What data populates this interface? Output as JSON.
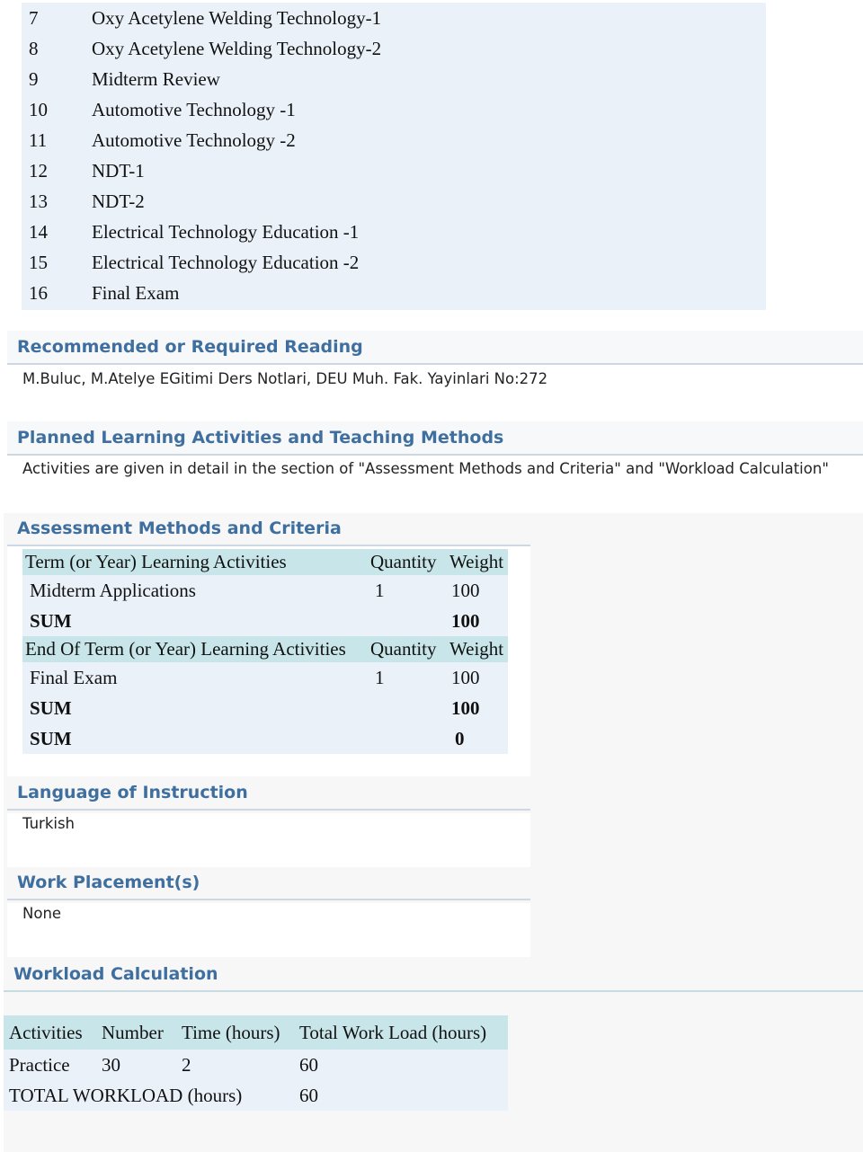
{
  "weekly_schedule": [
    {
      "week": "7",
      "topic": "Oxy Acetylene Welding Technology-1"
    },
    {
      "week": "8",
      "topic": "Oxy Acetylene Welding Technology-2"
    },
    {
      "week": "9",
      "topic": "Midterm Review"
    },
    {
      "week": "10",
      "topic": "Automotive Technology -1"
    },
    {
      "week": "11",
      "topic": "Automotive Technology -2"
    },
    {
      "week": "12",
      "topic": "NDT-1"
    },
    {
      "week": "13",
      "topic": "NDT-2"
    },
    {
      "week": "14",
      "topic": "Electrical Technology Education -1"
    },
    {
      "week": "15",
      "topic": "Electrical Technology Education -2"
    },
    {
      "week": "16",
      "topic": "Final Exam"
    }
  ],
  "reading": {
    "title": "Recommended or Required Reading",
    "text": "M.Buluc, M.Atelye EGitimi Ders Notlari, DEU Muh. Fak. Yayinlari No:272"
  },
  "planned": {
    "title": "Planned Learning Activities and Teaching Methods",
    "text": "Activities are given in detail in the section of \"Assessment Methods and Criteria\" and \"Workload Calculation\""
  },
  "assessment": {
    "title": "Assessment Methods and Criteria",
    "term_header": {
      "activity": "Term (or Year) Learning Activities",
      "quantity": "Quantity",
      "weight": "Weight"
    },
    "term_rows": [
      {
        "activity": "Midterm Applications",
        "quantity": "1",
        "weight": "100"
      }
    ],
    "term_sum": {
      "label": "SUM",
      "value": "100"
    },
    "end_header": {
      "activity": "End Of Term (or Year) Learning Activities",
      "quantity": "Quantity",
      "weight": "Weight"
    },
    "end_rows": [
      {
        "activity": "Final Exam",
        "quantity": "1",
        "weight": "100"
      }
    ],
    "end_sum": {
      "label": "SUM",
      "value": "100"
    },
    "total_sum": {
      "label": "SUM",
      "value": "0"
    }
  },
  "language": {
    "title": "Language of Instruction",
    "text": "Turkish"
  },
  "work_placement": {
    "title": "Work Placement(s)",
    "text": "None"
  },
  "workload": {
    "title": "Workload Calculation",
    "headers": [
      "Activities",
      "Number",
      "Time (hours)",
      "Total Work Load (hours)"
    ],
    "rows": [
      {
        "activity": "Practice",
        "number": "30",
        "time": "2",
        "total": "60"
      }
    ],
    "total": {
      "label": "TOTAL WORKLOAD (hours)",
      "value": "60"
    }
  },
  "colors": {
    "heading": "#3f6f9f",
    "table_body": "#eaf1f9",
    "table_header": "#c8e6e9",
    "panel": "#f7f7f7"
  }
}
